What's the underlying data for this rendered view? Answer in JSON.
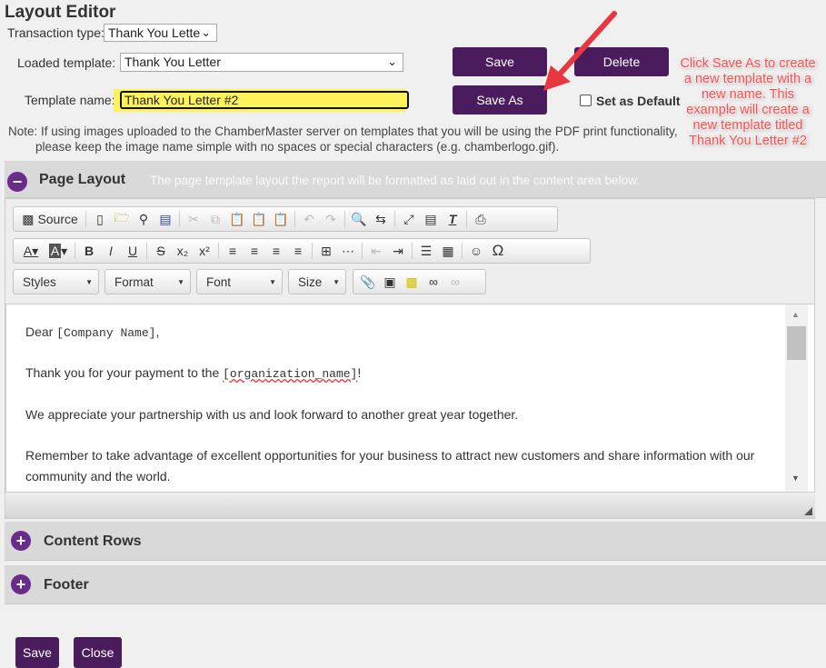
{
  "title": "Layout Editor",
  "transaction_type": {
    "label": "Transaction type:",
    "value": "Thank You Lette"
  },
  "loaded_template": {
    "label": "Loaded template:",
    "value": "Thank You Letter"
  },
  "template_name": {
    "label": "Template name:",
    "value": "Thank You Letter #2"
  },
  "buttons": {
    "save": "Save",
    "delete": "Delete",
    "save_as": "Save As",
    "set_default": "Set as Default",
    "bottom_save": "Save",
    "close": "Close"
  },
  "note": {
    "line1": "Note: If using images uploaded to the ChamberMaster server on templates that you will be using the PDF print functionality,",
    "line2": "please keep the image name simple with no spaces or special characters (e.g. chamberlogo.gif)."
  },
  "callout": "Click Save As to create a new template with a new name. This example will create a new template titled Thank You Letter #2",
  "panels": {
    "page_layout": {
      "title": "Page Layout",
      "description": "The page template layout the report will be formatted as laid out in the content area below."
    },
    "content_rows": {
      "title": "Content Rows"
    },
    "footer": {
      "title": "Footer"
    }
  },
  "toolbar": {
    "source": "Source",
    "combos": [
      "Styles",
      "Format",
      "Font",
      "Size"
    ]
  },
  "content": {
    "p1_a": "Dear ",
    "p1_field": "[Company Name]",
    "p1_b": ",",
    "p2_a": "Thank you for your payment to the ",
    "p2_field": "[organization_name]",
    "p2_b": "!",
    "p3": "We appreciate your partnership with us and look forward to another great year together.",
    "p4": "Remember to take advantage of excellent opportunities for your business to attract new customers and share information with our community and the world."
  },
  "colors": {
    "button": "#4a1c5e",
    "callout": "#ff4d4d",
    "highlight": "#fff35a",
    "arrow": "#e8373e"
  }
}
